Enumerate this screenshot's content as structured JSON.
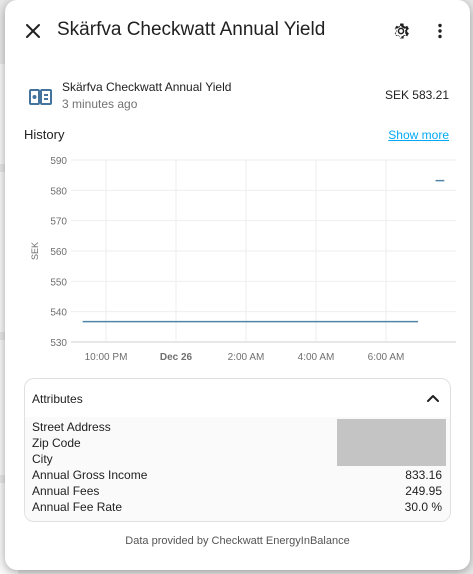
{
  "dialog": {
    "title": "Skärfva Checkwatt Annual Yield",
    "close_icon": "close-icon",
    "settings_icon": "gear-icon",
    "more_icon": "more-vertical-icon"
  },
  "entity": {
    "icon": "cash-register-icon",
    "name": "Skärfva Checkwatt Annual Yield",
    "last_changed": "3 minutes ago",
    "state": "SEK 583.21"
  },
  "history": {
    "title": "History",
    "show_more": "Show more"
  },
  "chart_data": {
    "type": "line",
    "title": "",
    "xlabel": "",
    "ylabel": "SEK",
    "ylim": [
      530,
      590
    ],
    "y_ticks": [
      "590",
      "580",
      "570",
      "560",
      "550",
      "540",
      "530"
    ],
    "x_ticks": [
      "10:00 PM",
      "Dec 26",
      "2:00 AM",
      "4:00 AM",
      "6:00 AM"
    ],
    "series": [
      {
        "color": "#4f86a8",
        "segments": [
          {
            "x": [
              "9:20 PM",
              "6:55 AM"
            ],
            "y": [
              536.7,
              536.7
            ]
          },
          {
            "x": [
              "7:25 AM",
              "7:40 AM"
            ],
            "y": [
              583.2,
              583.2
            ]
          }
        ]
      }
    ],
    "grid": true
  },
  "attributes": {
    "label": "Attributes",
    "chevron_icon": "chevron-up-icon",
    "rows": [
      {
        "key": "Street Address",
        "value": ""
      },
      {
        "key": "Zip Code",
        "value": ""
      },
      {
        "key": "City",
        "value": ""
      },
      {
        "key": "Annual Gross Income",
        "value": "833.16"
      },
      {
        "key": "Annual Fees",
        "value": "249.95"
      },
      {
        "key": "Annual Fee Rate",
        "value": "30.0 %"
      }
    ]
  },
  "footer": {
    "attribution": "Data provided by Checkwatt EnergyInBalance"
  }
}
